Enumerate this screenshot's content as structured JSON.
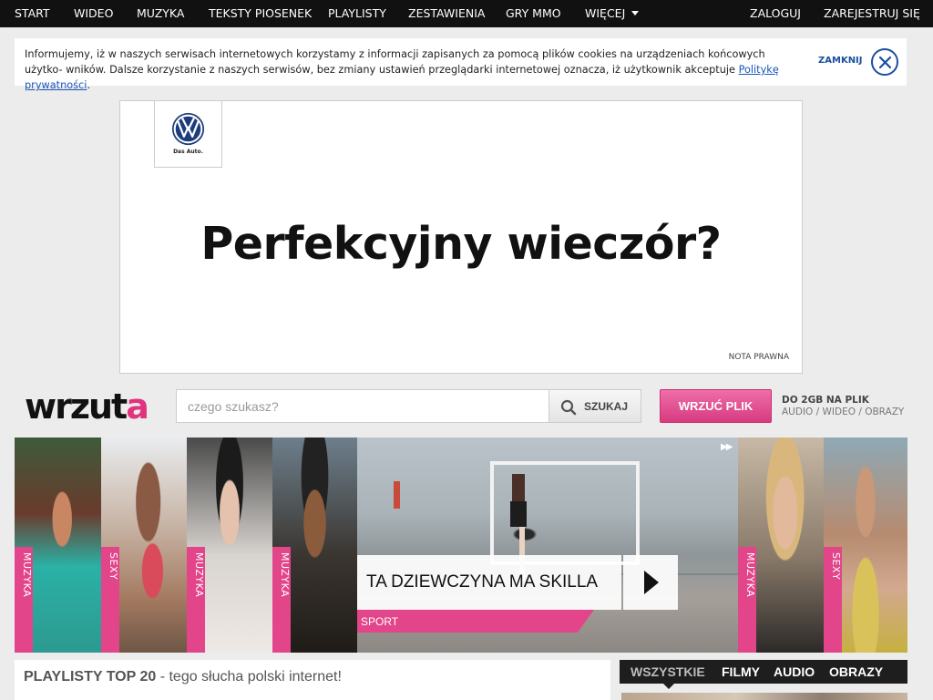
{
  "nav": {
    "items": [
      "Start",
      "Wideo",
      "Muzyka",
      "Teksty piosenek",
      "Playlisty",
      "Zestawienia",
      "Gry MMO",
      "Więcej"
    ],
    "login": "Zaloguj",
    "register": "Zarejestruj się"
  },
  "cookie": {
    "text": "Informujemy, iż w naszych serwisach internetowych korzystamy z informacji zapisanych za pomocą plików cookies na urządzeniach końcowych użytko- wników. Dalsze korzystanie z naszych serwisów, bez zmiany ustawień przeglądarki internetowej oznacza, iż użytkownik akceptuje",
    "link": "Politykę prywatności",
    "close_label": "ZAMKNIJ"
  },
  "ad": {
    "brand_tag": "Das Auto.",
    "headline": "Perfekcyjny wieczór?",
    "legal": "Nota prawna"
  },
  "logo": {
    "main": "wrzut",
    "accent": "a"
  },
  "search": {
    "placeholder": "czego szukasz?",
    "button": "Szukaj"
  },
  "upload": {
    "button": "Wrzuć plik",
    "line1": "Do 2GB na plik",
    "line2": "Audio / Wideo / Obrazy"
  },
  "carousel": {
    "tiles": [
      "Muzyka",
      "Sexy",
      "Muzyka",
      "Muzyka",
      "Muzyka",
      "Sexy"
    ],
    "feature_title": "Ta dziewczyna ma skilla",
    "feature_category": "Sport"
  },
  "playlists": {
    "title": "PLAYLISTY TOP 20",
    "subtitle": " - tego słucha polski internet!"
  },
  "tabs": [
    "Wszystkie",
    "Filmy",
    "Audio",
    "Obrazy"
  ],
  "colors": {
    "accent": "#e2458a",
    "nav_bg": "#111111",
    "link": "#1a55b8"
  }
}
